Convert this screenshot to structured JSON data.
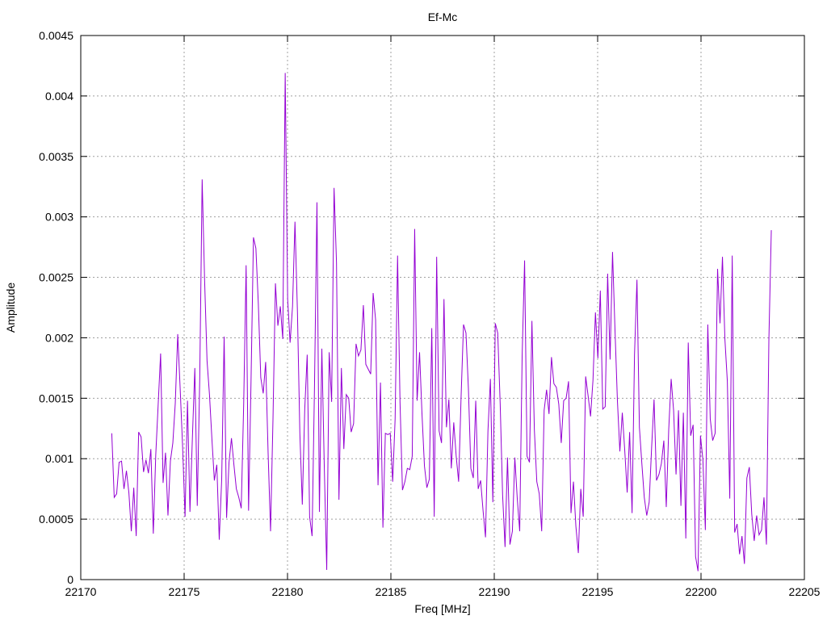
{
  "chart_data": {
    "type": "line",
    "title": "Ef-Mc",
    "xlabel": "Freq [MHz]",
    "ylabel": "Amplitude",
    "xlim": [
      22170,
      22205
    ],
    "ylim": [
      0,
      0.0045
    ],
    "grid": true,
    "legend": "none",
    "x_ticks": [
      "22170",
      "22175",
      "22180",
      "22185",
      "22190",
      "22195",
      "22200",
      "22205"
    ],
    "y_ticks": [
      "0",
      "0.0005",
      "0.001",
      "0.0015",
      "0.002",
      "0.0025",
      "0.003",
      "0.0035",
      "0.004",
      "0.0045"
    ],
    "series": [
      {
        "color": "#9400d3",
        "x_start": 22171.5,
        "x_end": 22203.4,
        "values": [
          0.00121,
          0.00068,
          0.00071,
          0.00097,
          0.00098,
          0.00075,
          0.0009,
          0.00072,
          0.0004,
          0.00076,
          0.00036,
          0.00122,
          0.00118,
          0.00089,
          0.00099,
          0.00088,
          0.00108,
          0.00038,
          0.00103,
          0.00145,
          0.00187,
          0.0008,
          0.00105,
          0.00053,
          0.00098,
          0.00113,
          0.00146,
          0.00203,
          0.00158,
          0.0011,
          0.00052,
          0.00148,
          0.00056,
          0.00117,
          0.00175,
          0.00061,
          0.00165,
          0.00331,
          0.00248,
          0.00181,
          0.00153,
          0.00116,
          0.00082,
          0.00095,
          0.00033,
          0.00083,
          0.00201,
          0.00051,
          0.00097,
          0.00117,
          0.00095,
          0.00075,
          0.00068,
          0.00059,
          0.00145,
          0.0026,
          0.00057,
          0.00163,
          0.00283,
          0.00274,
          0.00228,
          0.00167,
          0.00154,
          0.0018,
          0.00105,
          0.0004,
          0.00133,
          0.00245,
          0.0021,
          0.00226,
          0.00199,
          0.00419,
          0.00232,
          0.00196,
          0.00226,
          0.00296,
          0.00222,
          0.00121,
          0.00062,
          0.00141,
          0.00186,
          0.00052,
          0.00036,
          0.00161,
          0.00312,
          0.00056,
          0.00191,
          0.00093,
          8e-05,
          0.00188,
          0.00147,
          0.00324,
          0.00262,
          0.00066,
          0.00175,
          0.00108,
          0.00153,
          0.0015,
          0.00122,
          0.00129,
          0.00195,
          0.00185,
          0.0019,
          0.00227,
          0.00178,
          0.00174,
          0.0017,
          0.00237,
          0.00215,
          0.00078,
          0.00163,
          0.00043,
          0.00121,
          0.0012,
          0.00121,
          0.00081,
          0.00133,
          0.00268,
          0.00147,
          0.00074,
          0.00081,
          0.00092,
          0.00091,
          0.00102,
          0.0029,
          0.00148,
          0.00188,
          0.00137,
          0.00094,
          0.00076,
          0.00083,
          0.00208,
          0.00052,
          0.00267,
          0.00123,
          0.00113,
          0.00232,
          0.00126,
          0.00149,
          0.00092,
          0.0013,
          0.00102,
          0.00081,
          0.00151,
          0.00211,
          0.00204,
          0.00158,
          0.00092,
          0.00084,
          0.00148,
          0.00075,
          0.00082,
          0.00057,
          0.00035,
          0.00123,
          0.00166,
          0.00064,
          0.00212,
          0.00204,
          0.00146,
          0.0007,
          0.00027,
          0.00101,
          0.00029,
          0.0004,
          0.00101,
          0.00067,
          0.0004,
          0.00185,
          0.00264,
          0.00102,
          0.00097,
          0.00214,
          0.00124,
          0.00081,
          0.00071,
          0.0004,
          0.0014,
          0.00157,
          0.00137,
          0.00184,
          0.00162,
          0.00159,
          0.00145,
          0.00113,
          0.00148,
          0.0015,
          0.00164,
          0.00055,
          0.00081,
          0.00044,
          0.00022,
          0.00075,
          0.00052,
          0.00168,
          0.00152,
          0.00135,
          0.00165,
          0.00221,
          0.00183,
          0.00239,
          0.00141,
          0.00143,
          0.00253,
          0.00182,
          0.00271,
          0.00207,
          0.00148,
          0.00106,
          0.00138,
          0.00107,
          0.00072,
          0.00122,
          0.00055,
          0.00186,
          0.00248,
          0.00126,
          0.00096,
          0.00068,
          0.00053,
          0.00064,
          0.00109,
          0.00149,
          0.00082,
          0.00087,
          0.00096,
          0.00115,
          0.0006,
          0.00124,
          0.00166,
          0.0014,
          0.00087,
          0.0014,
          0.00061,
          0.00138,
          0.00034,
          0.00196,
          0.00119,
          0.00128,
          0.00019,
          7e-05,
          0.00119,
          0.00099,
          0.00041,
          0.00211,
          0.00133,
          0.00115,
          0.00121,
          0.00257,
          0.00212,
          0.00267,
          0.00199,
          0.00164,
          0.00067,
          0.00268,
          0.00039,
          0.00046,
          0.00021,
          0.00036,
          0.00013,
          0.00084,
          0.00093,
          0.00054,
          0.00032,
          0.00053,
          0.00037,
          0.00041,
          0.00068,
          0.00029,
          0.00198,
          0.00289
        ]
      }
    ]
  }
}
